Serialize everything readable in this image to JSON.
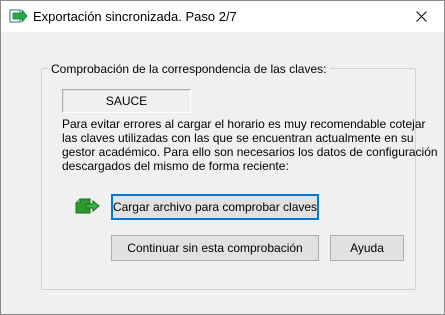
{
  "window": {
    "title": "Exportación sincronizada. Paso 2/7",
    "icons": {
      "app": "export-arrow-icon",
      "close": "close-icon"
    }
  },
  "group": {
    "legend": "Comprobación de la correspondencia de las claves:",
    "key_value": "SAUCE",
    "description_lines": [
      "Para evitar errores al cargar el horario es muy recomendable cotejar",
      "las claves utilizadas con las que se encuentran actualmente en su",
      "gestor académico. Para ello son necesarios los datos de configuración",
      "descargados del mismo de forma reciente:"
    ],
    "file_icon": "green-file-export-icon"
  },
  "buttons": {
    "load_file": "Cargar archivo para comprobar claves",
    "continue_without": "Continuar sin esta comprobación",
    "help": "Ayuda"
  },
  "colors": {
    "focus_border": "#0078d7",
    "icon_green": "#2e9b2e"
  }
}
